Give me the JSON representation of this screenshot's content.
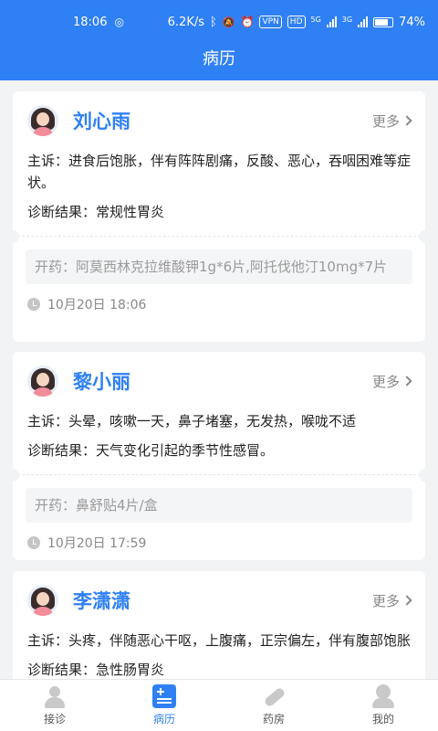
{
  "status_bar": {
    "time": "18:06",
    "network_speed": "6.2K/s",
    "vpn": "VPN",
    "hd": "HD",
    "sig1": "5G",
    "sig2": "3G",
    "battery": "74%"
  },
  "header": {
    "title": "病历"
  },
  "records": [
    {
      "name": "刘心雨",
      "more": "更多",
      "complaint": "主诉：进食后饱胀，伴有阵阵剧痛，反酸、恶心，吞咽困难等症状。",
      "diagnosis": "诊断结果：常规性胃炎",
      "prescription": "开药：阿莫西林克拉维酸钾1g*6片,阿托伐他汀10mg*7片",
      "time": "10月20日 18:06"
    },
    {
      "name": "黎小丽",
      "more": "更多",
      "complaint": "主诉：头晕，咳嗽一天，鼻子堵塞，无发热，喉咙不适",
      "diagnosis": "诊断结果：天气变化引起的季节性感冒。",
      "prescription": "开药：鼻舒贴4片/盒",
      "time": "10月20日 17:59"
    },
    {
      "name": "李潇潇",
      "more": "更多",
      "complaint": "主诉：头疼，伴随恶心干呕，上腹痛，正宗偏左，伴有腹部饱胀",
      "diagnosis": "诊断结果：急性肠胃炎"
    }
  ],
  "nav": [
    {
      "label": "接诊",
      "icon": "doctor-icon",
      "active": false
    },
    {
      "label": "病历",
      "icon": "medical-record-icon",
      "active": true
    },
    {
      "label": "药房",
      "icon": "pill-icon",
      "active": false
    },
    {
      "label": "我的",
      "icon": "profile-icon",
      "active": false
    }
  ],
  "colors": {
    "primary": "#2f80f5",
    "background": "#f2f3f5"
  }
}
